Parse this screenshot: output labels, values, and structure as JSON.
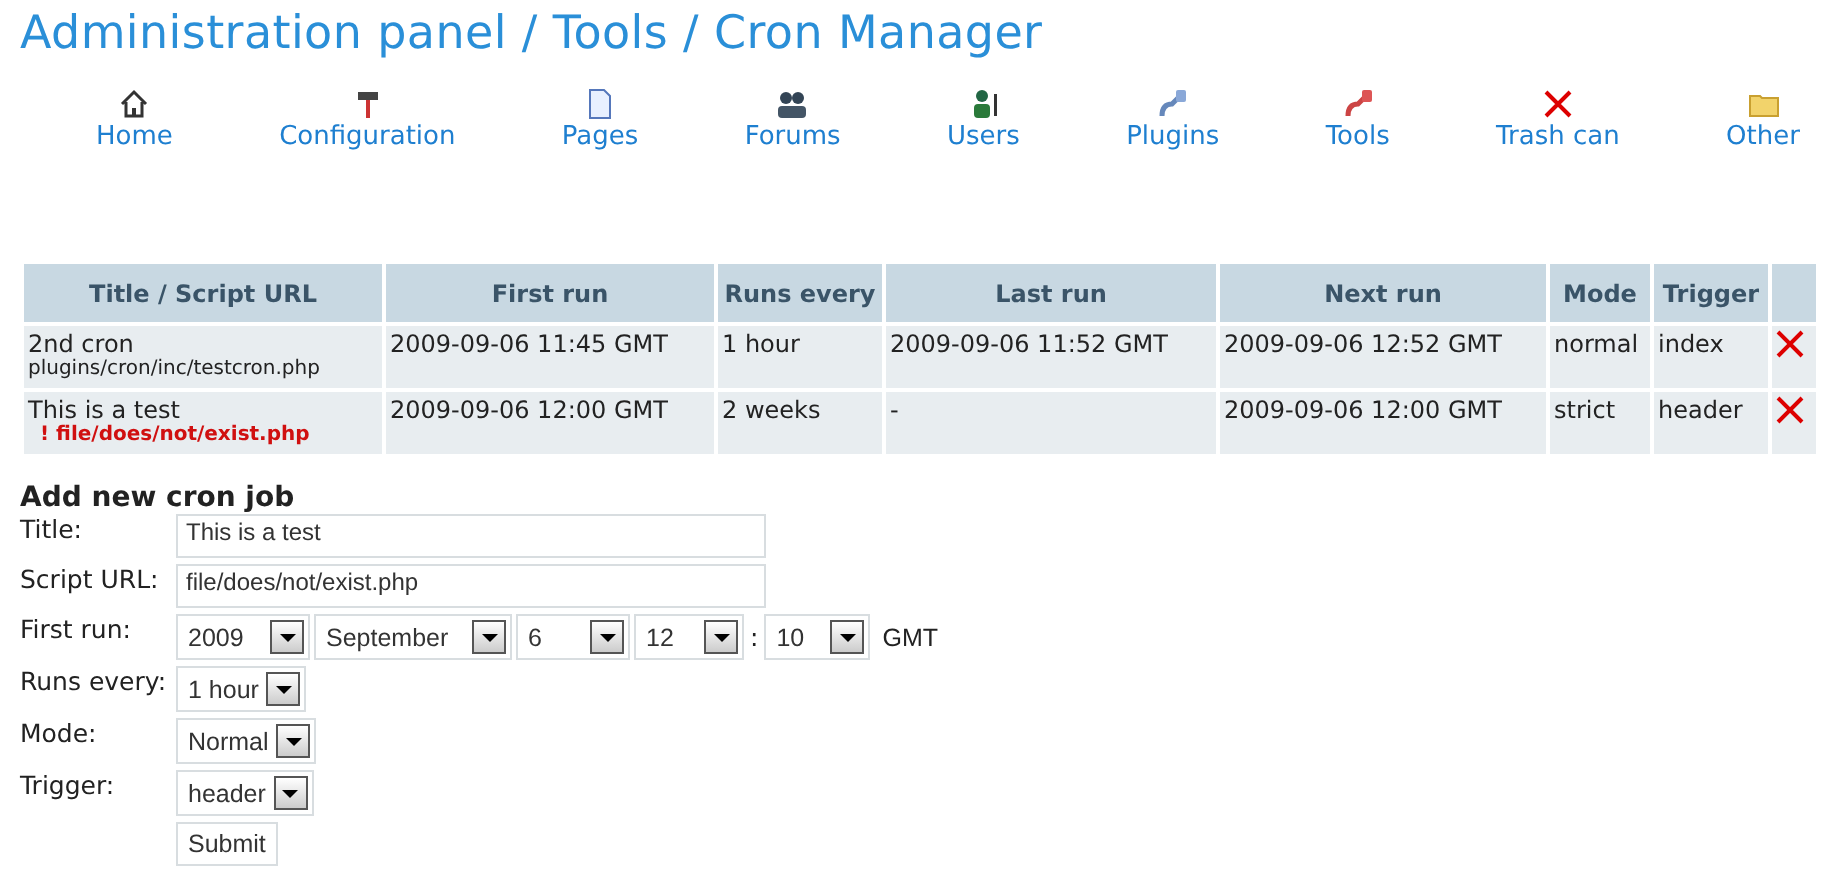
{
  "page_title": "Administration panel / Tools / Cron Manager",
  "nav": [
    {
      "label": "Home",
      "kind": "house"
    },
    {
      "label": "Configuration",
      "kind": "hammer"
    },
    {
      "label": "Pages",
      "kind": "page"
    },
    {
      "label": "Forums",
      "kind": "people"
    },
    {
      "label": "Users",
      "kind": "user"
    },
    {
      "label": "Plugins",
      "kind": "plug"
    },
    {
      "label": "Tools",
      "kind": "plugred"
    },
    {
      "label": "Trash can",
      "kind": "cross"
    },
    {
      "label": "Other",
      "kind": "folder"
    }
  ],
  "table": {
    "columns": [
      "Title / Script URL",
      "First run",
      "Runs every",
      "Last run",
      "Next run",
      "Mode",
      "Trigger"
    ],
    "rows": [
      {
        "title": "2nd cron",
        "url": "plugins/cron/inc/testcron.php",
        "missing": false,
        "first_run": "2009-09-06 11:45 GMT",
        "runs_every": "1 hour",
        "last_run": "2009-09-06 11:52 GMT",
        "next_run": "2009-09-06 12:52 GMT",
        "mode": "normal",
        "trigger": "index"
      },
      {
        "title": "This is a test",
        "url": "! file/does/not/exist.php",
        "missing": true,
        "first_run": "2009-09-06 12:00 GMT",
        "runs_every": "2 weeks",
        "last_run": "-",
        "next_run": "2009-09-06 12:00 GMT",
        "mode": "strict",
        "trigger": "header"
      }
    ]
  },
  "form": {
    "heading": "Add new cron job",
    "rows": [
      {
        "kind": "text",
        "label": "Title:",
        "value": "This is a test"
      },
      {
        "kind": "text",
        "label": "Script URL:",
        "value": "file/does/not/exist.php"
      },
      {
        "kind": "datetime",
        "label": "First run:",
        "selects": [
          "2009",
          "September",
          "6",
          "12",
          "10"
        ],
        "separator": ":",
        "zone": "GMT"
      },
      {
        "kind": "select",
        "label": "Runs every:",
        "value": "1 hour"
      },
      {
        "kind": "select",
        "label": "Mode:",
        "value": "Normal"
      },
      {
        "kind": "select",
        "label": "Trigger:",
        "value": "header"
      }
    ],
    "submit": "Submit"
  }
}
